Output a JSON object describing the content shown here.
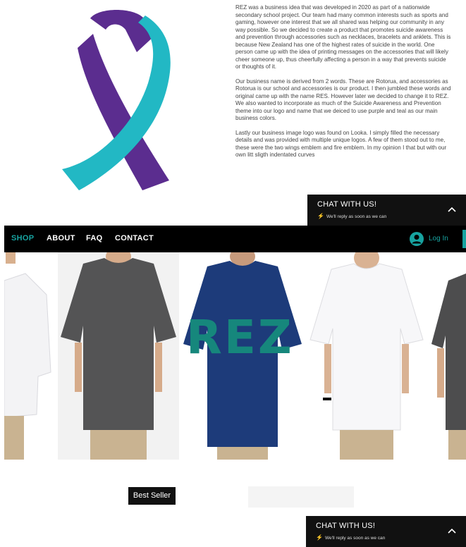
{
  "about": {
    "paragraphs": [
      "REZ was a business idea that was developed in 2020 as part of a nationwide secondary school project. Our team had many common interests such as sports and gaming, however one interest that we all shared was helping our community in any way possible. So we decided to create a product that promotes suicide awareness and prevention through accessories such as necklaces, bracelets and anklets. This is because New Zealand has one of the highest rates of suicide in the world. One person came up with the idea of printing messages on the accessories that will likely cheer someone up, thus cheerfully affecting a person in a way that prevents suicide or thoughts of it.",
      "Our business name is derived from 2 words. These are Rotorua, and accessories as Rotorua is our school and accessories is our product. I then jumbled these words and original came up with the name RES. However later we decided to change it to REZ. We also wanted to incorporate as much of the Suicide Awareness and Prevention theme into our logo and name that we deiced to use purple and teal as our main business colors.",
      "Lastly our business image logo was found on Looka. I simply filled the necessary details and was provided with multiple unique logos. A few of them stood out to me, these were the two wings emblem and fire emblem. In my opinion I that but with our own litt sligth indentated curves"
    ],
    "ribbon_colors": {
      "purple": "#5b2d8f",
      "teal": "#22b8c4"
    }
  },
  "chat": {
    "title": "CHAT WITH US!",
    "subtitle": "We'll reply as soon as we can"
  },
  "nav": {
    "items": [
      {
        "label": "SHOP",
        "active": true
      },
      {
        "label": "ABOUT",
        "active": false
      },
      {
        "label": "FAQ",
        "active": false
      },
      {
        "label": "CONTACT",
        "active": false
      }
    ],
    "login_label": "Log In",
    "accent_color": "#17a3a0"
  },
  "hero": {
    "logo_text": "REZ",
    "logo_color": "#16877c",
    "shirts": [
      "white",
      "dark-grey",
      "navy",
      "white",
      "dark-grey"
    ]
  },
  "badge": {
    "label": "Best Seller"
  }
}
